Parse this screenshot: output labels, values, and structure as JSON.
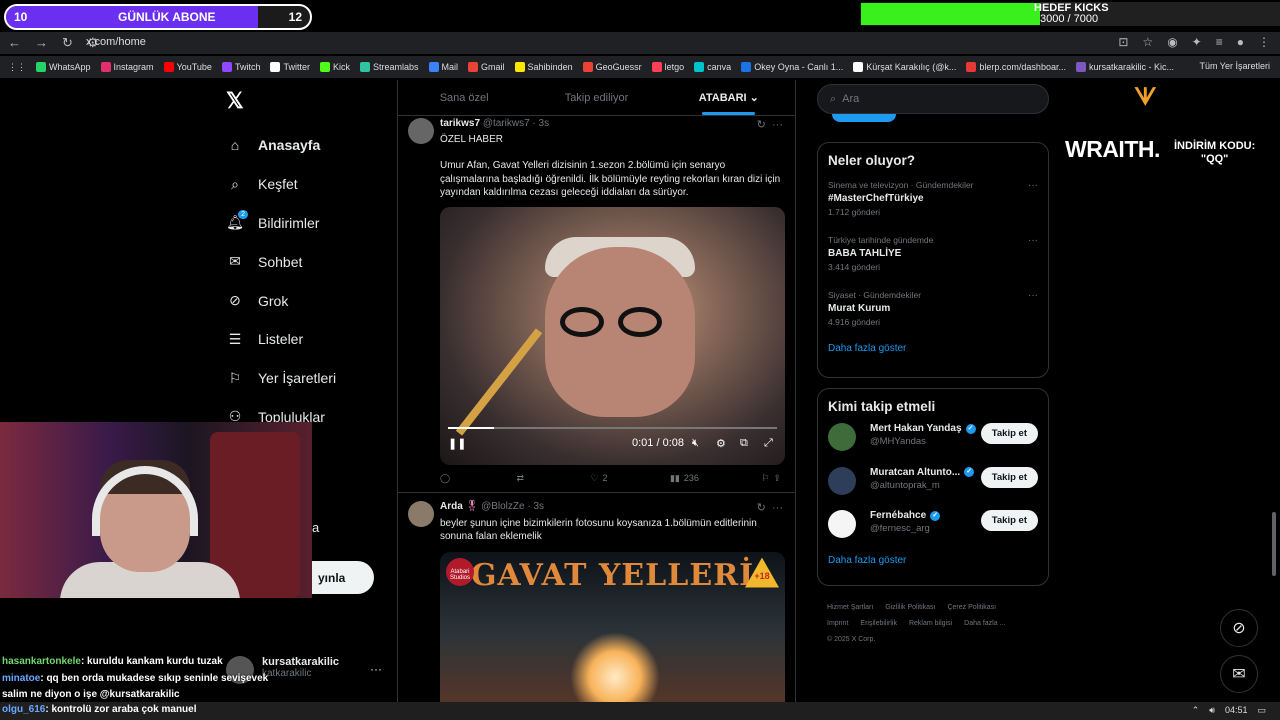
{
  "overlay": {
    "abone_current": "10",
    "abone_label": "GÜNLÜK ABONE",
    "abone_goal": "12",
    "abone_progress": 0.83,
    "kicks_title": "HEDEF KICKS",
    "kicks_count": "3000 / 7000",
    "kicks_progress": 0.43,
    "sponsor": "WRAITH.",
    "sponsor_code_label": "İNDİRİM KODU:",
    "sponsor_code": "\"QQ\""
  },
  "browser": {
    "url": "x.com/home",
    "bookmarks": [
      "WhatsApp",
      "Instagram",
      "YouTube",
      "Twitch",
      "Twitter",
      "Kick",
      "Streamlabs",
      "Mail",
      "Gmail",
      "Sahibinden",
      "GeoGuessr",
      "letgo",
      "canva",
      "Okey Oyna - Canlı 1...",
      "Kürşat Karakılıç (@k...",
      "blerp.com/dashboar...",
      "kursatkarakilic - Kic..."
    ],
    "all_bookmarks": "Tüm Yer İşaretleri"
  },
  "sidebar": {
    "logo": "𝕏",
    "items": [
      {
        "label": "Anasayfa",
        "icon": "home-icon"
      },
      {
        "label": "Keşfet",
        "icon": "search-icon"
      },
      {
        "label": "Bildirimler",
        "icon": "bell-icon",
        "badge": "2"
      },
      {
        "label": "Sohbet",
        "icon": "mail-icon"
      },
      {
        "label": "Grok",
        "icon": "grok-icon"
      },
      {
        "label": "Listeler",
        "icon": "list-icon"
      },
      {
        "label": "Yer İşaretleri",
        "icon": "bookmark-icon"
      },
      {
        "label": "Topluluklar",
        "icon": "community-icon"
      }
    ],
    "partial_item": "a",
    "post_button": "yınla",
    "account_name": "kursatkarakilic",
    "account_handle": "katkarakilic"
  },
  "tabs": [
    "Sana özel",
    "Takip ediliyor",
    "ATABARI"
  ],
  "tweets": [
    {
      "name": "tarikws7",
      "handle": "@tarikws7 · 3s",
      "subtitle": "ÖZEL HABER",
      "text": "Umur Afan, Gavat Yelleri dizisinin 1.sezon 2.bölümü için senaryo çalışmalarına başladığı öğrenildi. İlk bölümüyle reyting rekorları kıran dizi için yayından kaldırılma cezası geleceği iddiaları da sürüyor.",
      "video_time": "0:01 / 0:08",
      "video_progress": 0.14,
      "replies": "",
      "retweets": "",
      "likes": "2",
      "views": "236"
    },
    {
      "name": "Arda",
      "handle": "@BlolzZe · 3s",
      "text": "beyler şunun içine bizimkilerin fotosunu koysanıza 1.bölümün editlerinin sonuna falan eklemelik",
      "media_title": "GAVAT YELLERİ",
      "media_badge": "+18",
      "media_logo": "Atabari Studios"
    }
  ],
  "search": {
    "placeholder": "Ara"
  },
  "trends": {
    "title": "Neler oluyor?",
    "items": [
      {
        "category": "Sinema ve televizyon · Gündemdekiler",
        "name": "#MasterChefTürkiye",
        "count": "1.712 gönderi"
      },
      {
        "category": "Türkiye tarihinde gündemde",
        "name": "BABA TAHLİYE",
        "count": "3.414 gönderi"
      },
      {
        "category": "Siyaset · Gündemdekiler",
        "name": "Murat Kurum",
        "count": "4.916 gönderi"
      }
    ],
    "show_more": "Daha fazla göster"
  },
  "who_to_follow": {
    "title": "Kimi takip etmeli",
    "items": [
      {
        "name": "Mert Hakan Yandaş",
        "handle": "@MHYandas",
        "button": "Takip et"
      },
      {
        "name": "Muratcan Altunto...",
        "handle": "@altuntoprak_m",
        "button": "Takip et"
      },
      {
        "name": "Fernébahce",
        "handle": "@fernesc_arg",
        "button": "Takip et"
      }
    ],
    "show_more": "Daha fazla göster"
  },
  "footer": {
    "links": [
      "Hizmet Şartları",
      "Gizlilik Politikası",
      "Çerez Politikası",
      "Imprint",
      "Erişilebilirlik",
      "Reklam bilgisi",
      "Daha fazla ..."
    ],
    "copyright": "© 2025 X Corp."
  },
  "chat": [
    {
      "user": "hasankartonkele",
      "text": ": kuruldu kankam kurdu tuzak"
    },
    {
      "user": "minatoe",
      "text": ": qq ben orda mukadese sıkıp seninle sevişevek"
    },
    {
      "user": "",
      "text": "salim ne diyon o işe @kursatkarakilic"
    }
  ],
  "taskbar": {
    "chat_user": "olgu_616",
    "chat_text": ": kontrolü zor araba çok manuel",
    "time": "04:51"
  }
}
